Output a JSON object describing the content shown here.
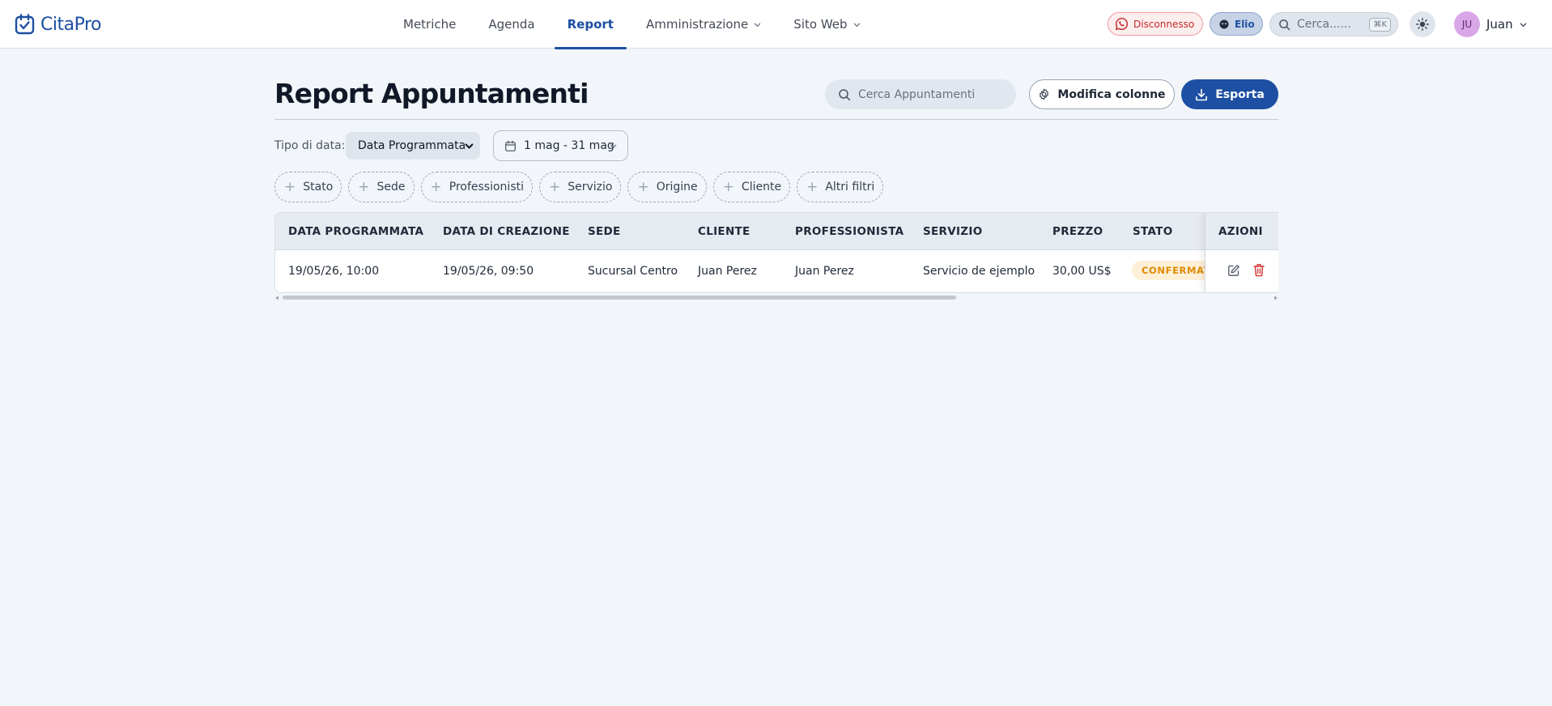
{
  "app": {
    "name": "CitaPro"
  },
  "nav": {
    "items": [
      {
        "label": "Metriche"
      },
      {
        "label": "Agenda"
      },
      {
        "label": "Report"
      },
      {
        "label": "Amministrazione"
      },
      {
        "label": "Sito Web"
      }
    ],
    "active": "Report"
  },
  "header_right": {
    "whatsapp_status": "Disconnesso",
    "assistant": "Elio",
    "search_placeholder": "Cerca......",
    "shortcut": "⌘K",
    "theme_icon": "sun-icon",
    "user_initials": "JU",
    "user_name": "Juan"
  },
  "page": {
    "title": "Report Appuntamenti",
    "search_placeholder": "Cerca Appuntamenti",
    "edit_columns_label": "Modifica colonne",
    "export_label": "Esporta"
  },
  "filters": {
    "date_type_label": "Tipo di data:",
    "date_type_value": "Data Programmata",
    "date_range": "1 mag - 31 mag",
    "chips": [
      "Stato",
      "Sede",
      "Professionisti",
      "Servizio",
      "Origine",
      "Cliente",
      "Altri filtri"
    ]
  },
  "table": {
    "columns": [
      "DATA PROGRAMMATA",
      "DATA DI CREAZIONE",
      "SEDE",
      "CLIENTE",
      "PROFESSIONISTA",
      "SERVIZIO",
      "PREZZO",
      "STATO",
      "AZIONI"
    ],
    "rows": [
      {
        "scheduled": "19/05/26, 10:00",
        "created": "19/05/26, 09:50",
        "location": "Sucursal Centro",
        "client": "Juan Perez",
        "professional": "Juan Perez",
        "service": "Servicio de ejemplo",
        "price": "30,00 US$",
        "status": "CONFERMATO"
      }
    ]
  },
  "colors": {
    "brand": "#1d4fa3",
    "background": "#f2f6fa",
    "status_confirmed_text": "#e08a00",
    "status_confirmed_bg": "#fdf0d7",
    "disconnected": "#c62828",
    "delete": "#d32f2f"
  }
}
